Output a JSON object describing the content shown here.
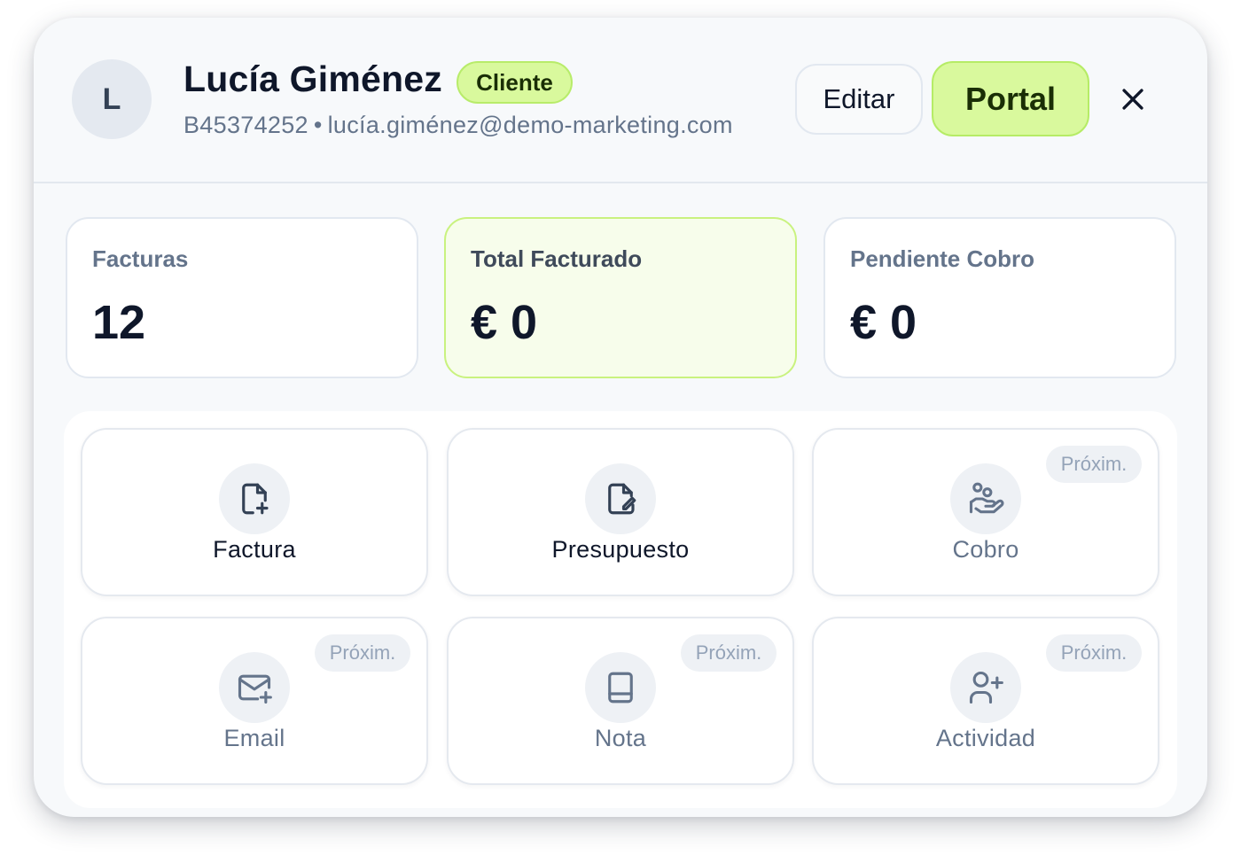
{
  "contact": {
    "avatar_initial": "L",
    "name": "Lucía Giménez",
    "badge": "Cliente",
    "tax_id": "B45374252",
    "separator": "•",
    "email": "lucía.giménez@demo-marketing.com"
  },
  "header_actions": {
    "edit_label": "Editar",
    "portal_label": "Portal",
    "close_icon": "close-icon"
  },
  "stats": [
    {
      "label": "Facturas",
      "value": "12"
    },
    {
      "label": "Total Facturado",
      "value": "€ 0",
      "highlight": true
    },
    {
      "label": "Pendiente Cobro",
      "value": "€ 0"
    }
  ],
  "quick_actions": [
    {
      "label": "Factura",
      "icon": "file-plus-icon",
      "coming_soon": false
    },
    {
      "label": "Presupuesto",
      "icon": "file-edit-icon",
      "coming_soon": false
    },
    {
      "label": "Cobro",
      "icon": "hand-coins-icon",
      "coming_soon": true,
      "badge": "Próxim."
    },
    {
      "label": "Email",
      "icon": "mail-plus-icon",
      "coming_soon": true,
      "badge": "Próxim."
    },
    {
      "label": "Nota",
      "icon": "notebook-icon",
      "coming_soon": true,
      "badge": "Próxim."
    },
    {
      "label": "Actividad",
      "icon": "user-plus-icon",
      "coming_soon": true,
      "badge": "Próxim."
    }
  ],
  "colors": {
    "accent": "#d9f99d",
    "accent_border": "#b6ec66",
    "text_primary": "#0f172a",
    "text_muted": "#64748b"
  }
}
